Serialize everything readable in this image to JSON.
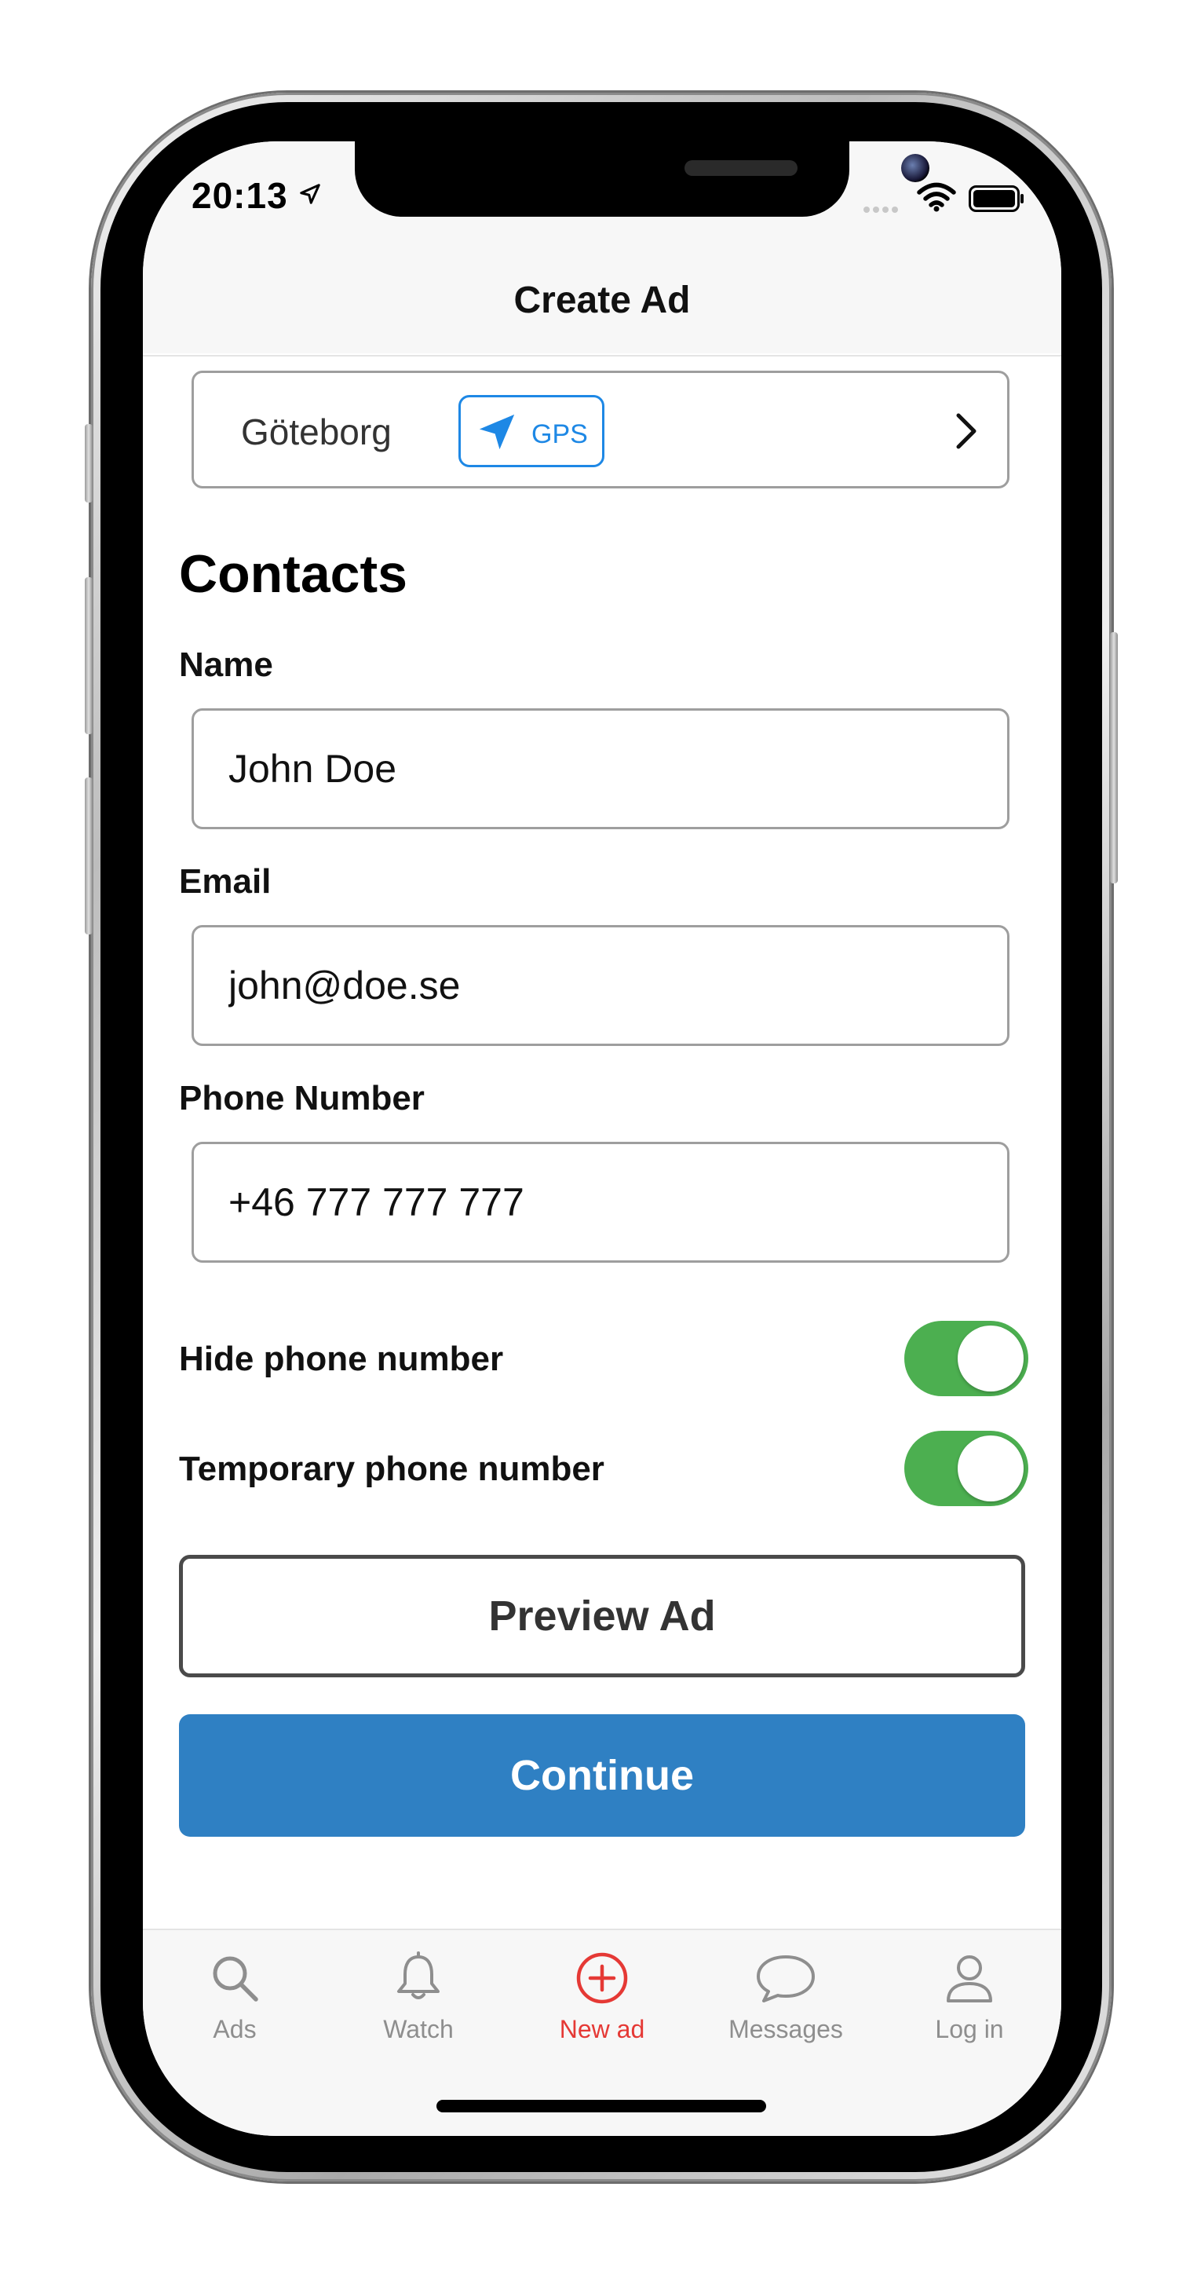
{
  "status_bar": {
    "time": "20:13"
  },
  "nav": {
    "title": "Create Ad"
  },
  "location": {
    "city": "Göteborg",
    "gps_label": "GPS"
  },
  "contacts": {
    "title": "Contacts",
    "name_label": "Name",
    "name_value": "John Doe",
    "email_label": "Email",
    "email_value": "john@doe.se",
    "phone_label": "Phone Number",
    "phone_value": "+46 777 777 777"
  },
  "toggles": {
    "hide_phone_label": "Hide phone number",
    "hide_phone_on": true,
    "temp_phone_label": "Temporary phone number",
    "temp_phone_on": true
  },
  "buttons": {
    "preview": "Preview Ad",
    "continue": "Continue"
  },
  "tab_bar": {
    "items": [
      {
        "label": "Ads",
        "icon": "search-icon"
      },
      {
        "label": "Watch",
        "icon": "bell-icon"
      },
      {
        "label": "New ad",
        "icon": "plus-circle-icon",
        "active": true
      },
      {
        "label": "Messages",
        "icon": "chat-bubble-icon"
      },
      {
        "label": "Log in",
        "icon": "user-icon"
      }
    ]
  },
  "colors": {
    "accent_blue": "#1e88e5",
    "toggle_green": "#4caf50",
    "continue_blue": "#2f80c3",
    "active_red": "#e53935"
  }
}
